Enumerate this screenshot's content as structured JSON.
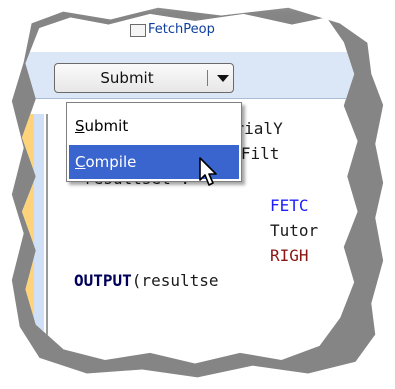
{
  "tab": {
    "label": "FetchPeop",
    "icon": "file-icon"
  },
  "toolbar": {
    "submit_label": "Submit",
    "submit_dropdown_icon": "chevron-down-icon"
  },
  "menu": {
    "items": [
      {
        "label": "Submit",
        "mnemonic": "S"
      },
      {
        "label": "Compile",
        "mnemonic": "C",
        "selected": true
      }
    ]
  },
  "code": {
    "lines": [
      {
        "text": "TutorialY"
      },
      {
        "text": "ZipFilt"
      },
      {
        "text": "resultset :="
      },
      {
        "text": "FETC"
      },
      {
        "text": "Tutor"
      },
      {
        "text": "RIGH"
      },
      {
        "text_kw": "OUTPUT",
        "text_rest": "(resultse"
      }
    ]
  },
  "colors": {
    "toolbar_bg": "#dbe6f6",
    "menu_selected": "#3a65cf",
    "keyword_blue": "#2020ff",
    "keyword_red": "#8b1515",
    "keyword_navy": "#00005a"
  },
  "cursor_icon": "arrow-cursor-icon"
}
